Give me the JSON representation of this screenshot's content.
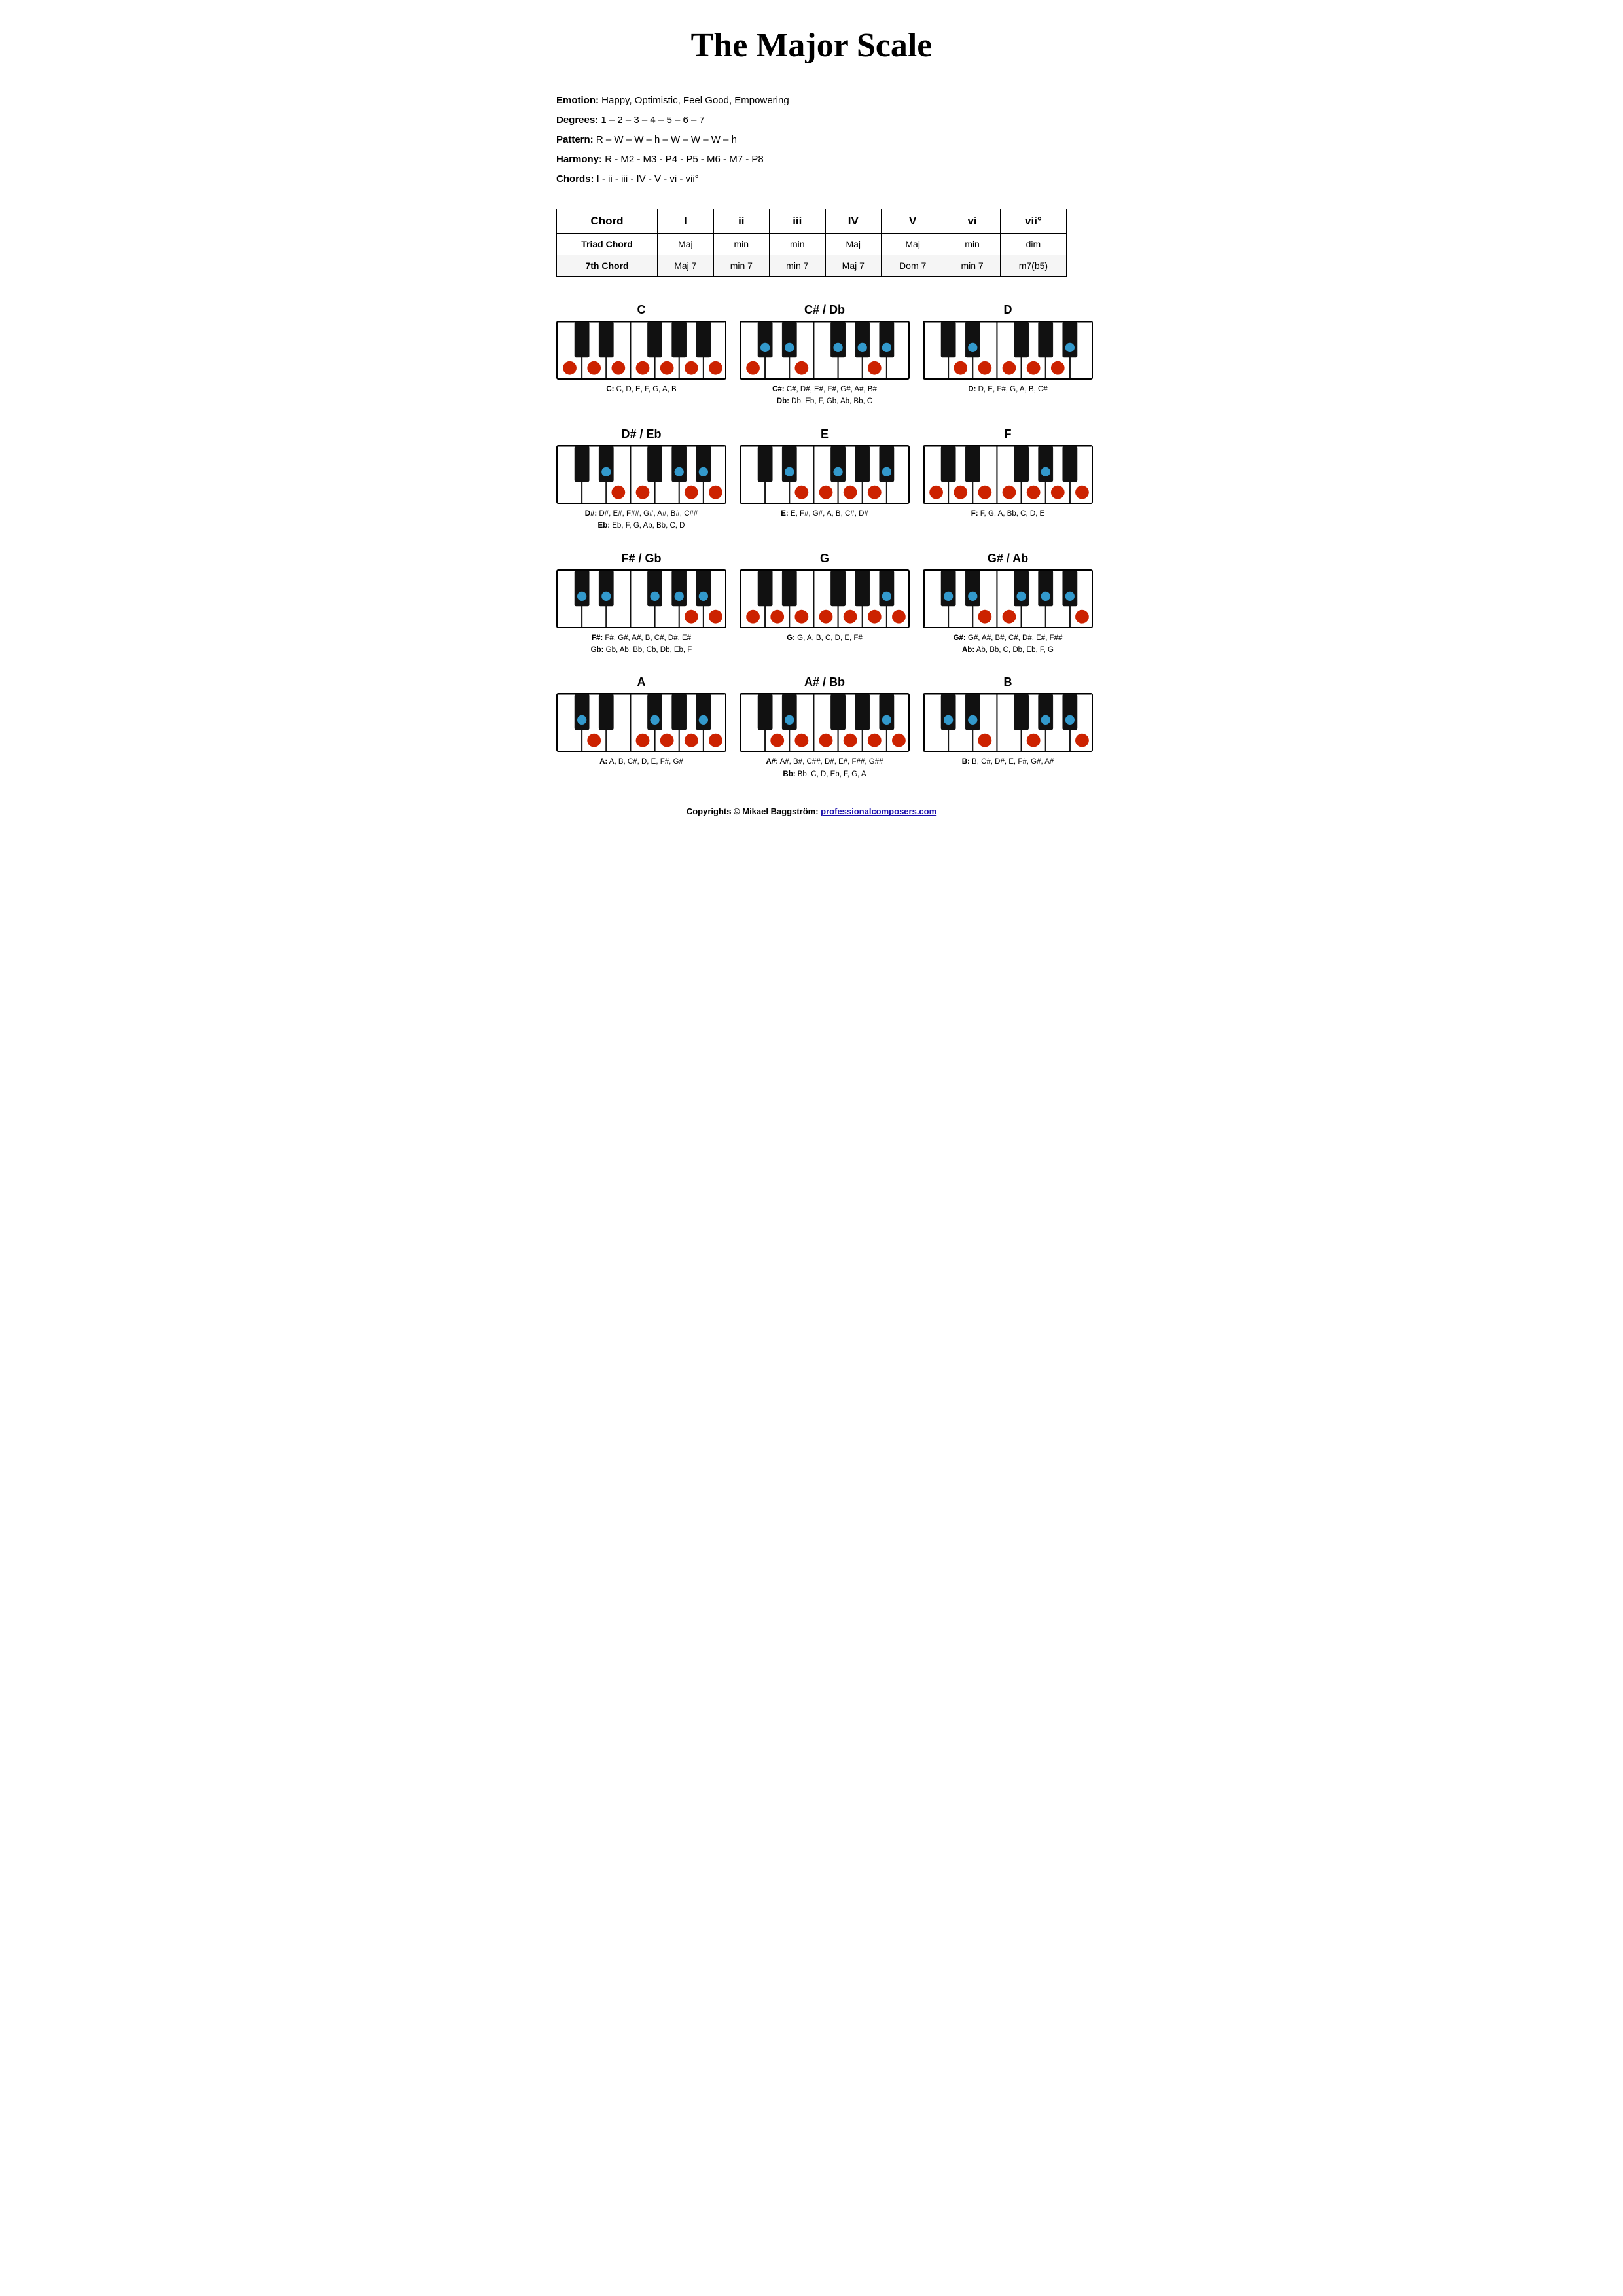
{
  "title": "The Major Scale",
  "info": {
    "emotion_label": "Emotion:",
    "emotion_value": "Happy, Optimistic, Feel Good, Empowering",
    "degrees_label": "Degrees:",
    "degrees_value": "1 – 2 – 3 – 4 – 5 – 6 – 7",
    "pattern_label": "Pattern:",
    "pattern_value": "R – W – W – h – W – W – W – h",
    "harmony_label": "Harmony:",
    "harmony_value": "R - M2 - M3 - P4 - P5 - M6 - M7 - P8",
    "chords_label": "Chords:",
    "chords_value": "I - ii - iii - IV - V - vi - vii°"
  },
  "table": {
    "headers": [
      "Chord",
      "I",
      "ii",
      "iii",
      "IV",
      "V",
      "vi",
      "vii°"
    ],
    "rows": [
      [
        "Triad Chord",
        "Maj",
        "min",
        "min",
        "Maj",
        "Maj",
        "min",
        "dim"
      ],
      [
        "7th Chord",
        "Maj 7",
        "min 7",
        "min 7",
        "Maj 7",
        "Dom 7",
        "min 7",
        "m7(b5)"
      ]
    ]
  },
  "keys": [
    {
      "id": "C",
      "title": "C",
      "notes_lines": [
        "C: C, D, E, F, G, A, B"
      ],
      "white_dots": [
        0,
        1,
        2,
        3,
        4,
        5,
        6
      ],
      "black_dots": []
    },
    {
      "id": "CsharpDb",
      "title": "C# / Db",
      "notes_lines": [
        "C#: C#, D#, E#, F#, G#, A#, B#",
        "Db: Db, Eb, F, Gb, Ab, Bb, C"
      ],
      "white_dots": [
        0,
        2,
        5
      ],
      "black_dots": [
        0,
        1,
        2,
        3,
        4
      ]
    },
    {
      "id": "D",
      "title": "D",
      "notes_lines": [
        "D: D, E, F#, G, A, B, C#"
      ],
      "white_dots": [
        1,
        2,
        3,
        4,
        5
      ],
      "black_dots": [
        1,
        4
      ]
    },
    {
      "id": "DsharpEb",
      "title": "D# / Eb",
      "notes_lines": [
        "D#: D#, E#, F##, G#, A#, B#, C##",
        "Eb: Eb, F, G, Ab, Bb, C, D"
      ],
      "white_dots": [
        2,
        3,
        5,
        6
      ],
      "black_dots": [
        1,
        3,
        4
      ]
    },
    {
      "id": "E",
      "title": "E",
      "notes_lines": [
        "E: E, F#, G#, A, B, C#, D#"
      ],
      "white_dots": [
        2,
        3,
        4,
        5
      ],
      "black_dots": [
        1,
        2,
        4
      ]
    },
    {
      "id": "F",
      "title": "F",
      "notes_lines": [
        "F: F, G, A, Bb, C, D, E"
      ],
      "white_dots": [
        3,
        4,
        5,
        6,
        0,
        1,
        2
      ],
      "black_dots": [
        3
      ]
    },
    {
      "id": "FsharpGb",
      "title": "F# / Gb",
      "notes_lines": [
        "F#: F#, G#, A#, B, C#, D#, E#",
        "Gb: Gb, Ab, Bb, Cb, Db, Eb, F"
      ],
      "white_dots": [
        5,
        6
      ],
      "black_dots": [
        2,
        3,
        4,
        0,
        1
      ]
    },
    {
      "id": "G",
      "title": "G",
      "notes_lines": [
        "G: G, A, B, C, D, E, F#"
      ],
      "white_dots": [
        4,
        5,
        6,
        0,
        1,
        2,
        3
      ],
      "black_dots": [
        4
      ]
    },
    {
      "id": "GsharpAb",
      "title": "G# / Ab",
      "notes_lines": [
        "G#: G#, A#, B#, C#, D#, E#, F##",
        "Ab: Ab, Bb, C, Db, Eb, F, G"
      ],
      "white_dots": [
        6,
        2,
        3
      ],
      "black_dots": [
        3,
        4,
        0,
        1,
        2
      ]
    },
    {
      "id": "A",
      "title": "A",
      "notes_lines": [
        "A: A, B, C#, D, E, F#, G#"
      ],
      "white_dots": [
        5,
        6,
        1,
        3,
        4
      ],
      "black_dots": [
        0,
        2,
        4
      ]
    },
    {
      "id": "AsharpBb",
      "title": "A# / Bb",
      "notes_lines": [
        "A#: A#, B#, C##, D#, E#, F##, G##",
        "Bb: Bb, C, D, Eb, F, G, A"
      ],
      "white_dots": [
        6,
        1,
        2,
        3,
        4,
        5
      ],
      "black_dots": [
        4,
        1
      ]
    },
    {
      "id": "B",
      "title": "B",
      "notes_lines": [
        "B: B, C#, D#, E, F#, G#, A#"
      ],
      "white_dots": [
        6,
        2,
        4
      ],
      "black_dots": [
        0,
        1,
        3,
        4
      ]
    }
  ],
  "copyright": {
    "text": "Copyrights © Mikael Baggström: ",
    "link_text": "professionalcomposers.com",
    "link_url": "https://professionalcomposers.com"
  }
}
